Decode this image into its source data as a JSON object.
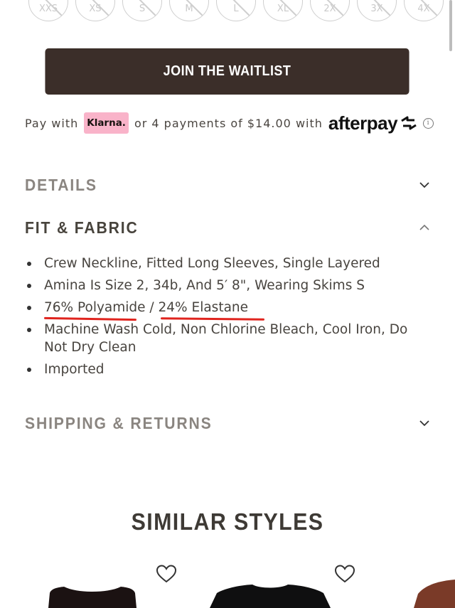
{
  "sizes": [
    "XXS",
    "XS",
    "S",
    "M",
    "L",
    "XL",
    "2X",
    "3X",
    "4X"
  ],
  "waitlist_button": "JOIN THE WAITLIST",
  "payment": {
    "pay_with": "Pay with",
    "klarna": "Klarna.",
    "or_payments": "or 4 payments of $14.00 with",
    "afterpay": "afterpay",
    "info": "i"
  },
  "accordion": {
    "details": "DETAILS",
    "fit_fabric": "FIT & FABRIC",
    "shipping": "SHIPPING & RETURNS"
  },
  "fit_fabric_items": [
    "Crew Neckline, Fitted Long Sleeves, Single Layered",
    "Amina Is Size 2, 34b, And 5′ 8\", Wearing Skims S",
    "76% Polyamide / 24% Elastane",
    "Machine Wash Cold, Non Chlorine Bleach, Cool Iron, Do Not Dry Clean",
    "Imported"
  ],
  "similar_styles": "SIMILAR STYLES",
  "colors": {
    "button_bg": "#3b2e29",
    "klarna_pink": "#f9b3c9",
    "annotation_red": "#e0241e"
  }
}
